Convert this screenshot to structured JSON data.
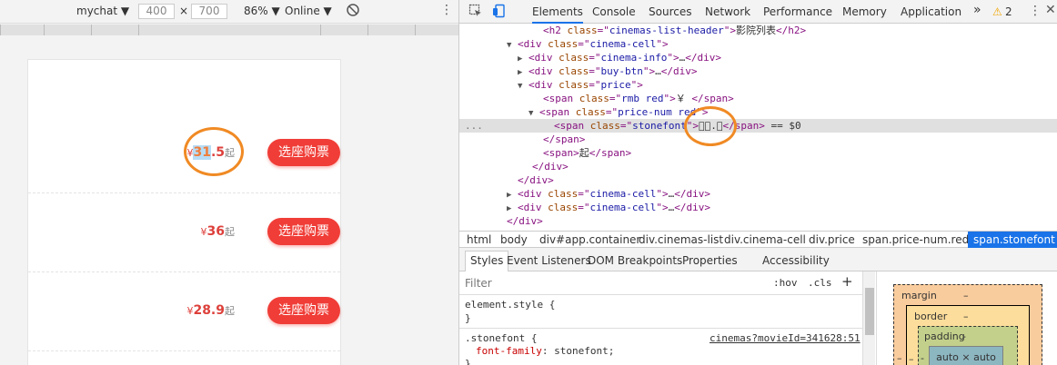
{
  "device_toolbar": {
    "device": "mychat",
    "width": "400",
    "times": "×",
    "height": "700",
    "zoom": "86%",
    "network": "Online"
  },
  "cinema_rows": [
    {
      "rmb": "¥",
      "price": "31.5",
      "price_highlight": "31",
      "price_rest": ".5",
      "suffix": "起",
      "button": "选座购票"
    },
    {
      "rmb": "¥",
      "price": "36",
      "suffix": "起",
      "button": "选座购票"
    },
    {
      "rmb": "¥",
      "price": "28.9",
      "suffix": "起",
      "button": "选座购票"
    }
  ],
  "devtools": {
    "tabs": [
      "Elements",
      "Console",
      "Sources",
      "Network",
      "Performance",
      "Memory",
      "Application"
    ],
    "more_tabs": "»",
    "warning_count": "2",
    "warning_glyph": "⚠",
    "dom_lines": [
      {
        "indent": 92,
        "tri": "",
        "parts": [
          [
            "tg",
            "<h2 "
          ],
          [
            "an",
            "class"
          ],
          [
            "tg",
            "=\""
          ],
          [
            "av",
            "cinemas-list-header"
          ],
          [
            "tg",
            "\">"
          ],
          [
            "tx",
            "影院列表"
          ],
          [
            "tg",
            "</h2>"
          ]
        ]
      },
      {
        "indent": 64,
        "tri": "▼",
        "parts": [
          [
            "tg",
            "<div "
          ],
          [
            "an",
            "class"
          ],
          [
            "tg",
            "=\""
          ],
          [
            "av",
            "cinema-cell"
          ],
          [
            "tg",
            "\">"
          ]
        ]
      },
      {
        "indent": 76,
        "tri": "▶",
        "parts": [
          [
            "tg",
            "<div "
          ],
          [
            "an",
            "class"
          ],
          [
            "tg",
            "=\""
          ],
          [
            "av",
            "cinema-info"
          ],
          [
            "tg",
            "\">"
          ],
          [
            "tx",
            "…"
          ],
          [
            "tg",
            "</div>"
          ]
        ]
      },
      {
        "indent": 76,
        "tri": "▶",
        "parts": [
          [
            "tg",
            "<div "
          ],
          [
            "an",
            "class"
          ],
          [
            "tg",
            "=\""
          ],
          [
            "av",
            "buy-btn"
          ],
          [
            "tg",
            "\">"
          ],
          [
            "tx",
            "…"
          ],
          [
            "tg",
            "</div>"
          ]
        ]
      },
      {
        "indent": 76,
        "tri": "▼",
        "parts": [
          [
            "tg",
            "<div "
          ],
          [
            "an",
            "class"
          ],
          [
            "tg",
            "=\""
          ],
          [
            "av",
            "price"
          ],
          [
            "tg",
            "\">"
          ]
        ]
      },
      {
        "indent": 92,
        "tri": "",
        "parts": [
          [
            "tg",
            "<span "
          ],
          [
            "an",
            "class"
          ],
          [
            "tg",
            "=\""
          ],
          [
            "av",
            "rmb red"
          ],
          [
            "tg",
            "\">"
          ],
          [
            "tx",
            "￥ "
          ],
          [
            "tg",
            "</span>"
          ]
        ]
      },
      {
        "indent": 88,
        "tri": "▼",
        "parts": [
          [
            "tg",
            "<span "
          ],
          [
            "an",
            "class"
          ],
          [
            "tg",
            "=\""
          ],
          [
            "av",
            "price-num red"
          ],
          [
            "tg",
            "\">"
          ]
        ]
      },
      {
        "indent": 104,
        "tri": "",
        "selected": true,
        "parts": [
          [
            "tg",
            "<span "
          ],
          [
            "an",
            "class"
          ],
          [
            "tg",
            "=\""
          ],
          [
            "av",
            "stonefont"
          ],
          [
            "tg",
            "\">"
          ],
          [
            "tx",
            "."
          ],
          [
            "tg",
            "</span>"
          ],
          [
            "tx",
            " == $0"
          ]
        ]
      },
      {
        "indent": 92,
        "tri": "",
        "parts": [
          [
            "tg",
            "</span>"
          ]
        ]
      },
      {
        "indent": 92,
        "tri": "",
        "parts": [
          [
            "tg",
            "<span>"
          ],
          [
            "tx",
            "起"
          ],
          [
            "tg",
            "</span>"
          ]
        ]
      },
      {
        "indent": 80,
        "tri": "",
        "parts": [
          [
            "tg",
            "</div>"
          ]
        ]
      },
      {
        "indent": 64,
        "tri": "",
        "parts": [
          [
            "tg",
            "</div>"
          ]
        ]
      },
      {
        "indent": 64,
        "tri": "▶",
        "parts": [
          [
            "tg",
            "<div "
          ],
          [
            "an",
            "class"
          ],
          [
            "tg",
            "=\""
          ],
          [
            "av",
            "cinema-cell"
          ],
          [
            "tg",
            "\">"
          ],
          [
            "tx",
            "…"
          ],
          [
            "tg",
            "</div>"
          ]
        ]
      },
      {
        "indent": 64,
        "tri": "▶",
        "parts": [
          [
            "tg",
            "<div "
          ],
          [
            "an",
            "class"
          ],
          [
            "tg",
            "=\""
          ],
          [
            "av",
            "cinema-cell"
          ],
          [
            "tg",
            "\">"
          ],
          [
            "tx",
            "…"
          ],
          [
            "tg",
            "</div>"
          ]
        ]
      },
      {
        "indent": 52,
        "tri": "",
        "parts": [
          [
            "tg",
            "</div>"
          ]
        ]
      }
    ],
    "ellipsis": "...",
    "breadcrumbs": [
      "html",
      "body",
      "div#app.container",
      "div.cinemas-list",
      "div.cinema-cell",
      "div.price",
      "span.price-num.red",
      "span.stonefont"
    ],
    "subtabs": [
      "Styles",
      "Event Listeners",
      "DOM Breakpoints",
      "Properties",
      "Accessibility"
    ],
    "styles": {
      "filter_placeholder": "Filter",
      "hov": ":hov",
      "cls": ".cls",
      "plus": "+",
      "element_style": "element.style {",
      "close1": "}",
      "rule_selector": ".stonefont {",
      "rule_source": "cinemas?movieId=341628:51",
      "rule_prop": "font-family",
      "rule_val": "stonefont;",
      "close2": "}"
    },
    "box_model": {
      "margin": "margin",
      "border": "border",
      "padding": "padding",
      "content": "auto × auto",
      "dash": "–",
      "padding_dash": "-"
    }
  },
  "colors": {
    "accent": "#1a73e8",
    "price_red": "#dd403b",
    "button_red": "#f03d37",
    "annotation": "#f08a24"
  }
}
